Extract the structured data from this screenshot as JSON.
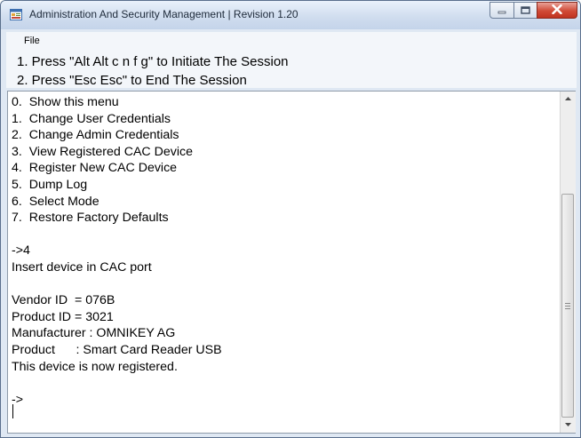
{
  "window": {
    "title": "Administration And Security Management  |  Revision 1.20",
    "icon": "app-window-icon",
    "controls": {
      "minimize": "minimize-icon",
      "maximize": "maximize-icon",
      "close": "close-icon"
    }
  },
  "menu": {
    "file": "File"
  },
  "instructions": [
    "1. Press \"Alt Alt c n f g\" to Initiate The Session",
    "2. Press \"Esc Esc\" to End The Session"
  ],
  "console": {
    "lines": [
      "0.  Show this menu",
      "1.  Change User Credentials",
      "2.  Change Admin Credentials",
      "3.  View Registered CAC Device",
      "4.  Register New CAC Device",
      "5.  Dump Log",
      "6.  Select Mode",
      "7.  Restore Factory Defaults",
      "",
      "->4",
      "Insert device in CAC port",
      "",
      "Vendor ID  = 076B",
      "Product ID = 3021",
      "Manufacturer : OMNIKEY AG",
      "Product      : Smart Card Reader USB",
      "This device is now registered.",
      "",
      "->"
    ]
  },
  "colors": {
    "title_bar": "#cfdcee",
    "close_button": "#d04a36",
    "console_bg": "#ffffff"
  }
}
